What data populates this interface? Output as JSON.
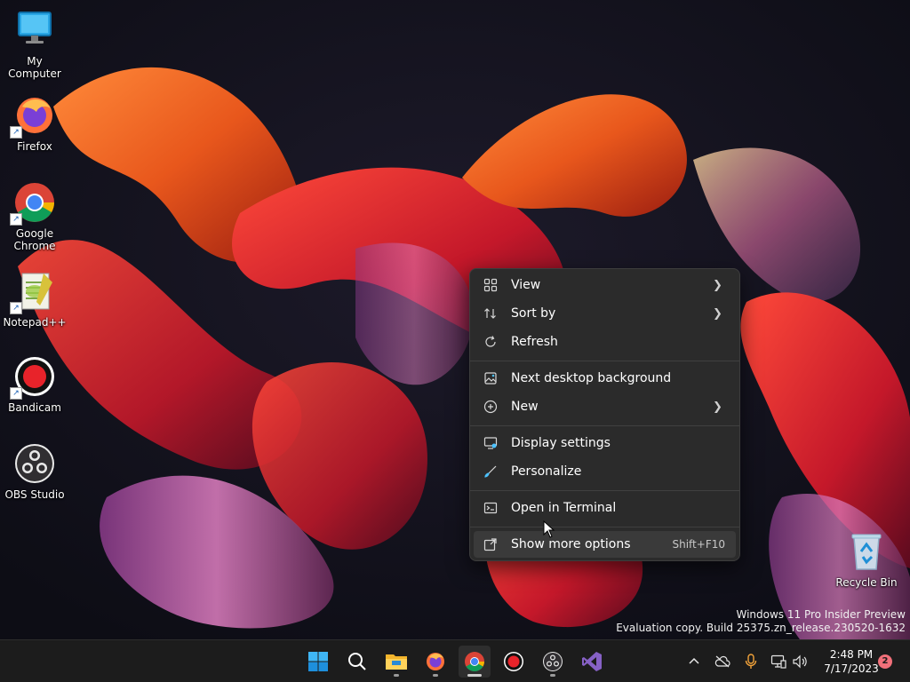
{
  "desktop": {
    "icons": [
      {
        "label": "My Computer",
        "icon": "monitor-icon"
      },
      {
        "label": "Firefox",
        "icon": "firefox-icon"
      },
      {
        "label": "Google Chrome",
        "icon": "chrome-icon"
      },
      {
        "label": "Notepad++",
        "icon": "notepadpp-icon"
      },
      {
        "label": "Bandicam",
        "icon": "bandicam-icon"
      },
      {
        "label": "OBS Studio",
        "icon": "obs-icon"
      }
    ],
    "recycle_bin": {
      "label": "Recycle Bin",
      "icon": "recycle-bin-icon"
    }
  },
  "context_menu": {
    "items": [
      {
        "label": "View",
        "icon": "view-grid-icon",
        "submenu": true
      },
      {
        "label": "Sort by",
        "icon": "sort-icon",
        "submenu": true
      },
      {
        "label": "Refresh",
        "icon": "refresh-icon",
        "submenu": false
      },
      {
        "label": "Next desktop background",
        "icon": "next-background-icon",
        "submenu": false
      },
      {
        "label": "New",
        "icon": "new-plus-icon",
        "submenu": true
      },
      {
        "label": "Display settings",
        "icon": "display-settings-icon",
        "submenu": false
      },
      {
        "label": "Personalize",
        "icon": "personalize-brush-icon",
        "submenu": false
      },
      {
        "label": "Open in Terminal",
        "icon": "terminal-icon",
        "submenu": false
      },
      {
        "label": "Show more options",
        "icon": "show-more-options-icon",
        "shortcut": "Shift+F10"
      }
    ]
  },
  "watermark": {
    "line1": "Windows 11 Pro Insider Preview",
    "line2": "Evaluation copy. Build 25375.zn_release.230520-1632"
  },
  "taskbar": {
    "apps": [
      {
        "name": "start-button",
        "icon": "windows-start-icon"
      },
      {
        "name": "search-button",
        "icon": "search-icon"
      },
      {
        "name": "file-explorer-button",
        "icon": "folder-icon"
      },
      {
        "name": "firefox-taskbar-button",
        "icon": "firefox-icon"
      },
      {
        "name": "chrome-taskbar-button",
        "icon": "chrome-icon"
      },
      {
        "name": "bandicam-taskbar-button",
        "icon": "bandicam-icon"
      },
      {
        "name": "obs-taskbar-button",
        "icon": "obs-icon"
      },
      {
        "name": "visual-studio-taskbar-button",
        "icon": "visual-studio-icon"
      }
    ],
    "tray": {
      "icons": [
        "chevron-up-icon",
        "onedrive-offline-icon",
        "microphone-icon",
        "network-icon",
        "volume-icon"
      ],
      "time": "2:48 PM",
      "date": "7/17/2023",
      "notification_count": "2"
    }
  },
  "colors": {
    "menu_bg": "#2b2b2b",
    "taskbar_bg": "#1c1c1c",
    "accent": "#4cc2ff",
    "badge": "#f1707a"
  }
}
